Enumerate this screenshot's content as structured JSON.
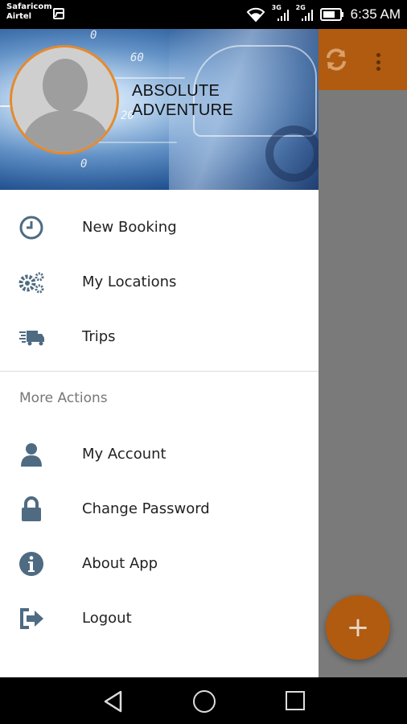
{
  "status_bar": {
    "carrier1": "Safaricom",
    "carrier2": "Airtel",
    "net1": "3G",
    "net2": "2G",
    "time": "6:35 AM"
  },
  "drawer": {
    "header": {
      "app_name": "ABSOLUTE ADVENTURE"
    },
    "primary_items": [
      {
        "label": "New Booking",
        "icon": "clock-icon"
      },
      {
        "label": "My Locations",
        "icon": "gears-icon"
      },
      {
        "label": "Trips",
        "icon": "truck-icon"
      }
    ],
    "section_title": "More Actions",
    "secondary_items": [
      {
        "label": "My Account",
        "icon": "user-icon"
      },
      {
        "label": "Change Password",
        "icon": "lock-icon"
      },
      {
        "label": "About App",
        "icon": "info-icon"
      },
      {
        "label": "Logout",
        "icon": "logout-icon"
      }
    ]
  },
  "background_app": {
    "fab_label": "+",
    "accent_color": "#b05b10"
  },
  "colors": {
    "icon": "#4e6b82",
    "avatar_ring": "#e58a2e"
  }
}
